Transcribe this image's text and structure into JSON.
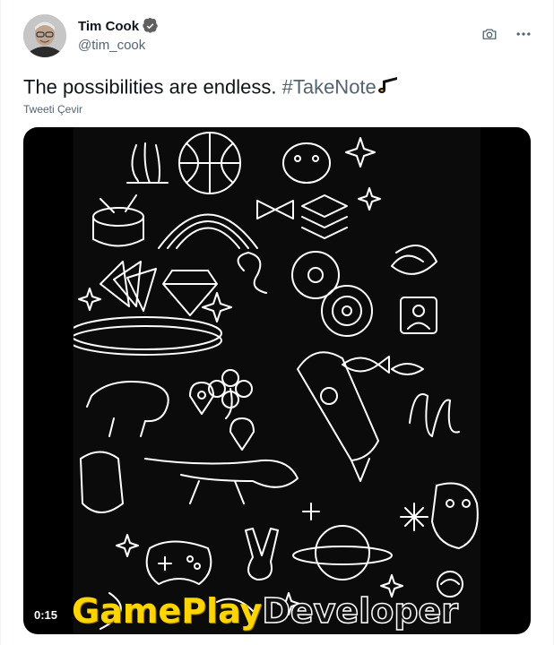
{
  "author": {
    "display_name": "Tim Cook",
    "handle": "@tim_cook",
    "verified": true
  },
  "tweet": {
    "text": "The possibilities are endless. ",
    "hashtag": "#TakeNote",
    "emoji": "musical-note-icon"
  },
  "translate_label": "Tweeti Çevir",
  "media": {
    "type": "video",
    "duration": "0:15"
  },
  "watermark": {
    "part1": "GamePlay",
    "part2": "Developer"
  },
  "colors": {
    "text_primary": "#0f1419",
    "text_secondary": "#536471",
    "verified_badge": "#606060",
    "media_background": "#000000",
    "watermark_yellow": "#ffd400"
  },
  "icons": [
    "verified-badge-icon",
    "camera-icon",
    "more-icon",
    "musical-note-icon"
  ]
}
